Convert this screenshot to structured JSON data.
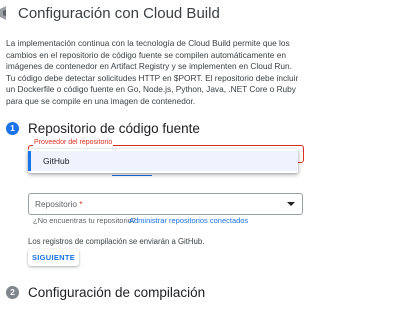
{
  "header": {
    "title": "Configuración con Cloud Build",
    "icon": "cloud-build-icon"
  },
  "intro": {
    "paragraph1": "La implementación continua con la tecnología de Cloud Build permite que los cambios en el repositorio de código fuente se compilen automáticamente en imágenes de contenedor en Artifact Registry y se implementen en Cloud Run.",
    "paragraph2": "Tu código debe detectar solicitudes HTTP en $PORT. El repositorio debe incluir un Dockerfile o código fuente en Go, Node.js, Python, Java, .NET Core o Ruby para que se compile en una imagen de contenedor."
  },
  "step1": {
    "number": "1",
    "title": "Repositorio de código fuente",
    "provider_label": "Proveedor del repositorio",
    "dropdown_options": [
      "GitHub"
    ],
    "repository_label": "Repositorio",
    "required_mark": "*",
    "helper_text": "¿No encuentras tu repositorio?",
    "helper_link": "Administrar repositorios conectados",
    "logs_note": "Los registros de compilación se enviarán a GitHub.",
    "next_button": "SIGUIENTE"
  },
  "step2": {
    "number": "2",
    "title": "Configuración de compilación"
  },
  "colors": {
    "accent": "#1a73e8",
    "error": "#d93025",
    "inactive_step": "#80868b"
  }
}
